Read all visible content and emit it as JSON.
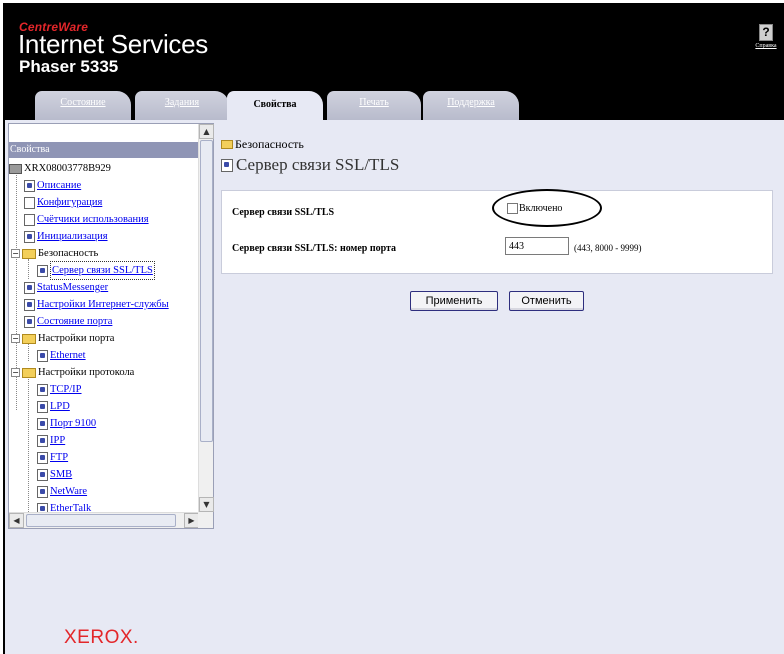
{
  "header": {
    "brand_small": "CentreWare",
    "brand_main": "Internet Services",
    "model": "Phaser 5335",
    "help_label": "Справка",
    "help_icon": "question-mark-icon"
  },
  "tabs": [
    {
      "label": "Состояние",
      "active": false
    },
    {
      "label": "Задания",
      "active": false
    },
    {
      "label": "Свойства",
      "active": true
    },
    {
      "label": "Печать",
      "active": false
    },
    {
      "label": "Поддержка",
      "active": false
    }
  ],
  "nav": {
    "title": "Свойства",
    "device": "XRX08003778B929",
    "items": {
      "description": "Описание",
      "configuration": "Конфигурация",
      "usage_counters": "Счётчики использования",
      "initialization": "Инициализация",
      "security": "Безопасность",
      "ssl_tls": "Сервер связи SSL/TLS",
      "status_messenger": "StatusMessenger",
      "internet_services_settings": "Настройки Интернет-службы",
      "port_status": "Состояние порта",
      "port_settings": "Настройки порта",
      "ethernet": "Ethernet",
      "protocol_settings": "Настройки протокола",
      "tcpip": "TCP/IP",
      "lpd": "LPD",
      "port9100": "Порт 9100",
      "ipp": "IPP",
      "ftp": "FTP",
      "smb": "SMB",
      "netware": "NetWare",
      "ethertalk": "EtherTalk"
    }
  },
  "main": {
    "breadcrumb": "Безопасность",
    "title": "Сервер связи SSL/TLS",
    "ssl_label": "Сервер связи SSL/TLS",
    "enabled_label": "Включено",
    "enabled_checked": false,
    "port_label": "Сервер связи SSL/TLS: номер порта",
    "port_value": "443",
    "port_range": "(443, 8000 - 9999)",
    "apply_button": "Применить",
    "cancel_button": "Отменить"
  },
  "footer": {
    "logo": "XEROX."
  },
  "colors": {
    "header_bg": "#000000",
    "brand_red": "#e3262a",
    "page_bg": "#e7e9f4",
    "nav_title_bg": "#8f95b5",
    "link": "#0000ee"
  }
}
